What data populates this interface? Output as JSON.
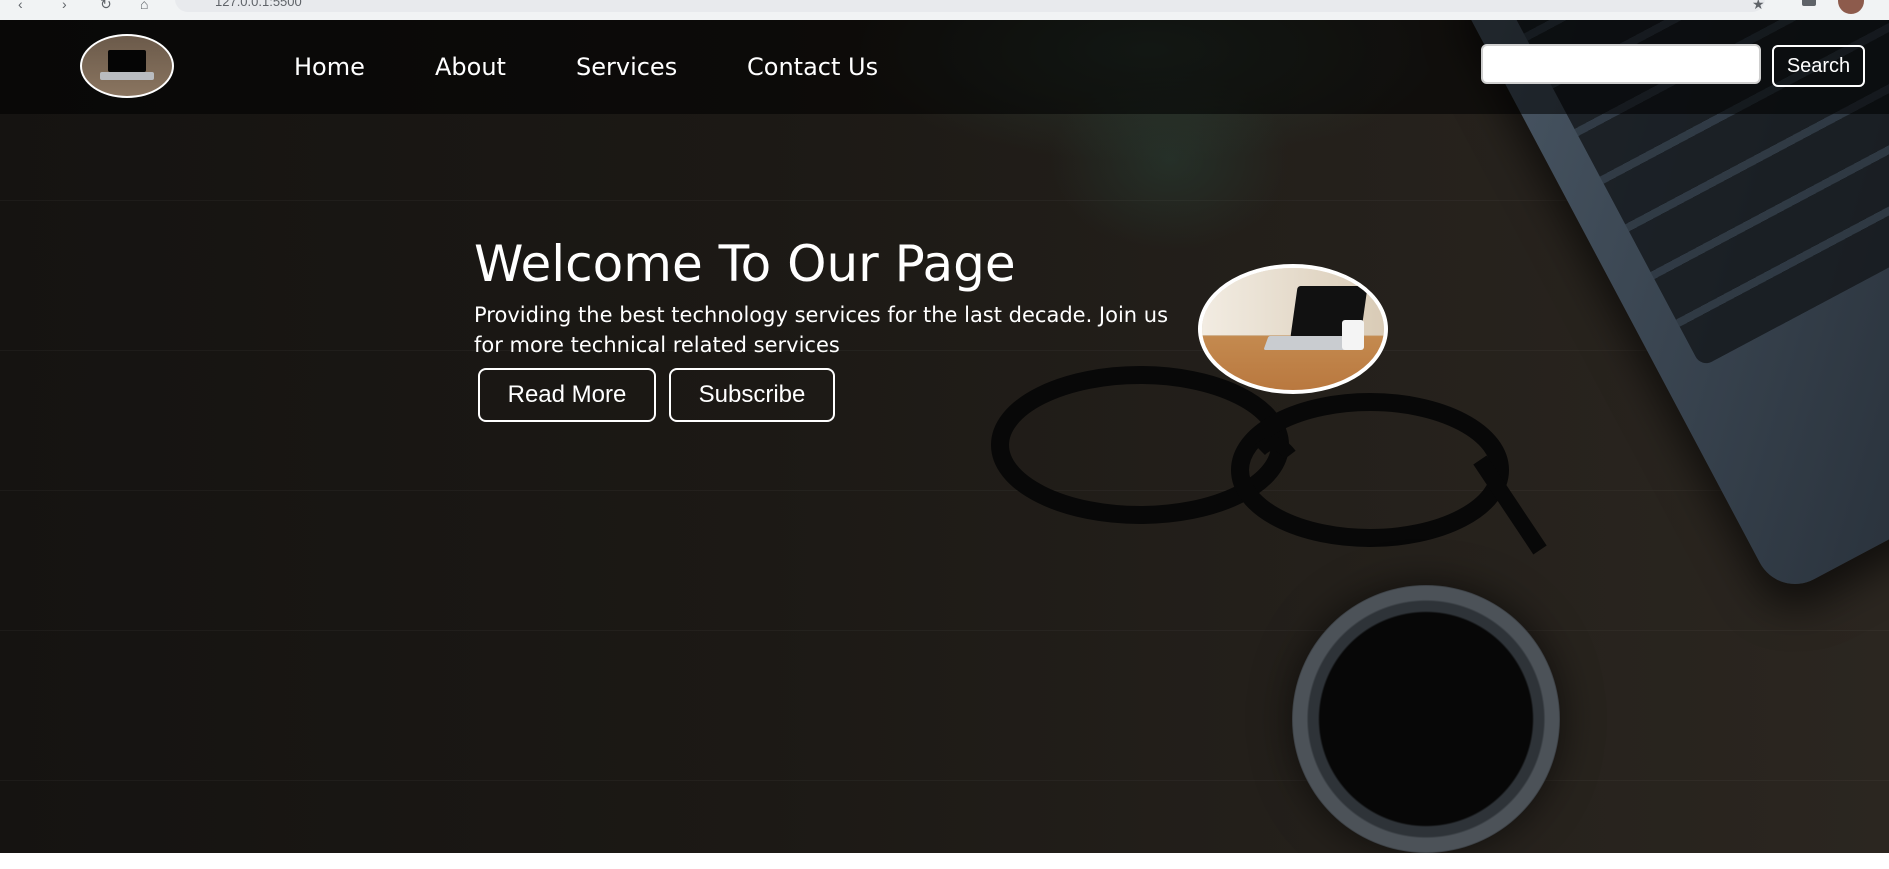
{
  "browser": {
    "address": "127.0.0.1:5500"
  },
  "navbar": {
    "links": [
      {
        "label": "Home"
      },
      {
        "label": "About"
      },
      {
        "label": "Services"
      },
      {
        "label": "Contact Us"
      }
    ],
    "search": {
      "value": "",
      "placeholder": "",
      "button_label": "Search"
    }
  },
  "hero": {
    "title": "Welcome To Our Page",
    "text": "Providing the best technology services for the last decade. Join us for more technical related services",
    "read_more_label": "Read More",
    "subscribe_label": "Subscribe"
  }
}
